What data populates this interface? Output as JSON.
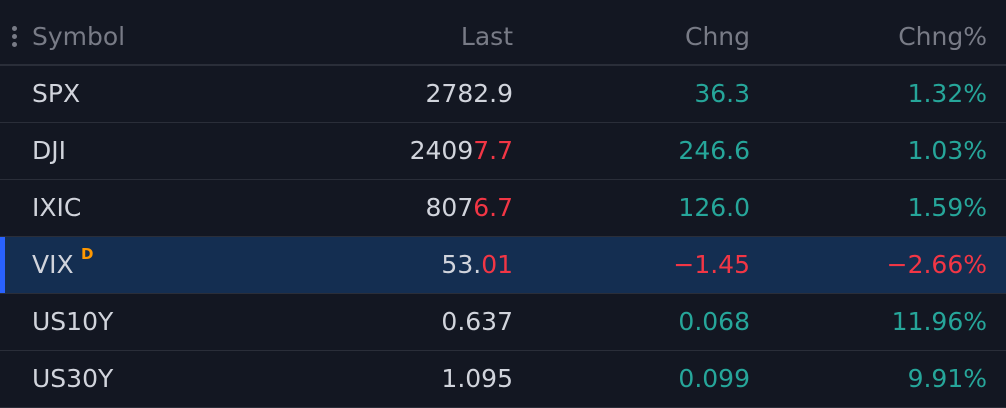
{
  "header": {
    "symbol_label": "Symbol",
    "last_label": "Last",
    "chng_label": "Chng",
    "chng_pct_label": "Chng%"
  },
  "colors": {
    "background": "#131722",
    "up": "#26a69a",
    "down": "#f23645",
    "selected_row": "#142e51",
    "delay_badge": "#ff9800"
  },
  "icons": {
    "drag_handle": "vertical-dots-icon"
  },
  "rows": [
    {
      "symbol": "SPX",
      "last_main": "2782.9",
      "last_tick": "",
      "chng": "36.3",
      "chng_pct": "1.32%",
      "direction": "up",
      "badge": ""
    },
    {
      "symbol": "DJI",
      "last_main": "2409",
      "last_tick": "7.7",
      "chng": "246.6",
      "chng_pct": "1.03%",
      "direction": "up",
      "badge": ""
    },
    {
      "symbol": "IXIC",
      "last_main": "807",
      "last_tick": "6.7",
      "chng": "126.0",
      "chng_pct": "1.59%",
      "direction": "up",
      "badge": ""
    },
    {
      "symbol": "VIX",
      "last_main": "53.",
      "last_tick": "01",
      "chng": "−1.45",
      "chng_pct": "−2.66%",
      "direction": "down",
      "badge": "D",
      "selected": true
    },
    {
      "symbol": "US10Y",
      "last_main": "0.637",
      "last_tick": "",
      "chng": "0.068",
      "chng_pct": "11.96%",
      "direction": "up",
      "badge": ""
    },
    {
      "symbol": "US30Y",
      "last_main": "1.095",
      "last_tick": "",
      "chng": "0.099",
      "chng_pct": "9.91%",
      "direction": "up",
      "badge": ""
    }
  ]
}
